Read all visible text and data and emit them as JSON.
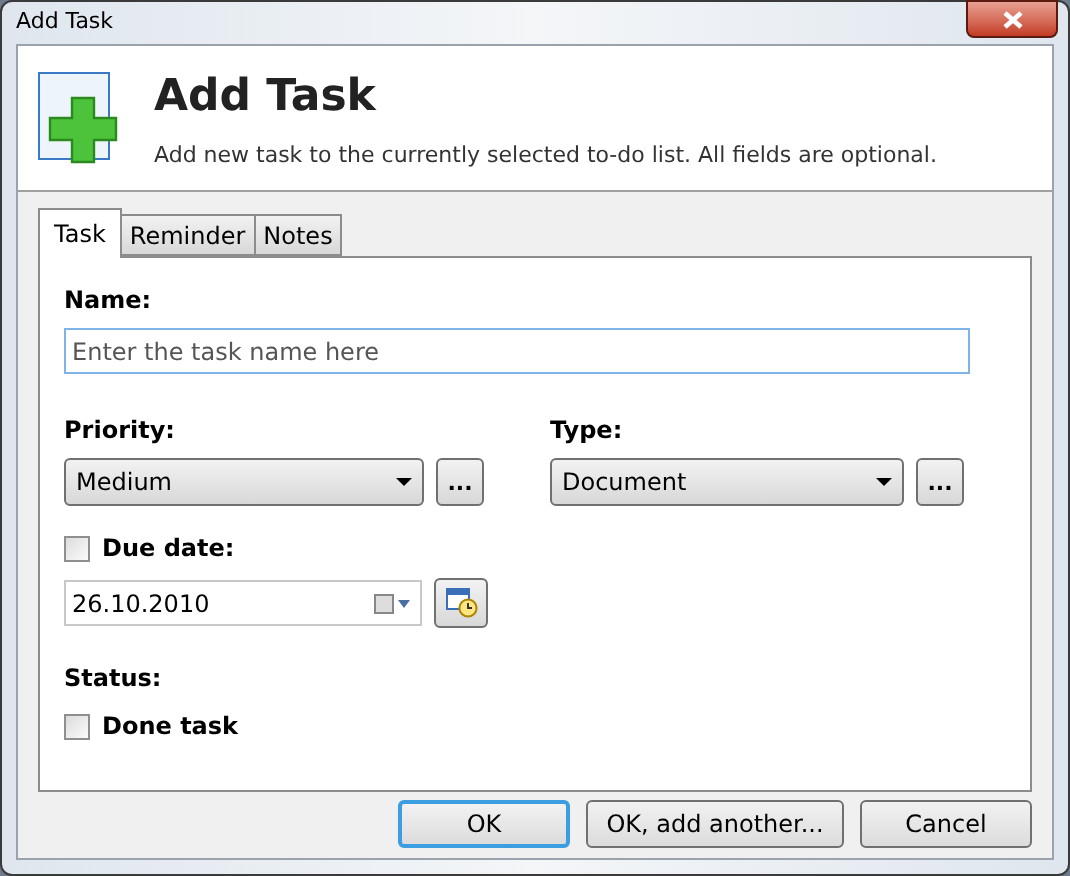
{
  "window": {
    "title": "Add Task"
  },
  "header": {
    "title": "Add Task",
    "description": "Add new task to the currently selected to-do list. All fields are optional."
  },
  "tabs": [
    {
      "label": "Task",
      "selected": true
    },
    {
      "label": "Reminder",
      "selected": false
    },
    {
      "label": "Notes",
      "selected": false
    }
  ],
  "name": {
    "label": "Name:",
    "placeholder": "Enter the task name here"
  },
  "priority": {
    "label": "Priority:",
    "value": "Medium",
    "more": "..."
  },
  "type": {
    "label": "Type:",
    "value": "Document",
    "more": "..."
  },
  "due_date": {
    "label": "Due date:",
    "checked": false,
    "value": "26.10.2010"
  },
  "status": {
    "label": "Status:",
    "done": {
      "label": "Done task",
      "checked": false
    }
  },
  "buttons": [
    {
      "label": "OK",
      "default": true
    },
    {
      "label": "OK, add another...",
      "default": false
    },
    {
      "label": "Cancel",
      "default": false
    }
  ]
}
